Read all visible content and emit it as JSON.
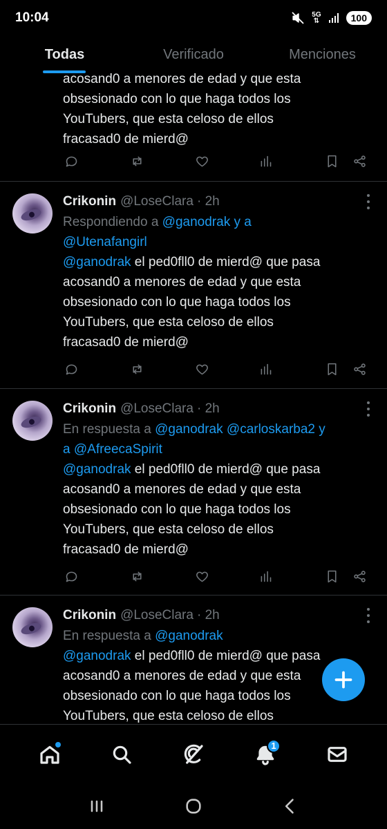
{
  "status_bar": {
    "time": "10:04",
    "network": "5G",
    "battery": "100",
    "icons": [
      "mute-icon",
      "5g-icon",
      "signal-icon",
      "battery-icon"
    ]
  },
  "tabs": [
    {
      "label": "Todas",
      "active": true
    },
    {
      "label": "Verificado",
      "active": false
    },
    {
      "label": "Menciones",
      "active": false
    }
  ],
  "posts": [
    {
      "partial": true,
      "text_lines": [
        "acosand0 a menores de edad y que esta",
        "obsesionado con lo que haga todos los",
        "YouTubers, que esta celoso de ellos",
        "fracasad0 de mierd@"
      ]
    },
    {
      "name": "Crikonin",
      "handle": "@LoseClara",
      "time": "· 2h",
      "reply_prefix": "Respondiendo a",
      "reply_line1_mention": "@ganodrak",
      "reply_line1_suffix": " y a",
      "reply_line2_mention": "@Utenafangirl",
      "text_mention": "@ganodrak",
      "text_first": " el ped0fll0 de mierd@ que pasa",
      "text_lines": [
        "acosand0 a menores de edad y que esta",
        "obsesionado con lo que haga todos los",
        "YouTubers, que esta celoso de ellos",
        "fracasad0 de mierd@"
      ]
    },
    {
      "name": "Crikonin",
      "handle": "@LoseClara",
      "time": "· 2h",
      "reply_prefix": "En respuesta a",
      "reply_mention1": "@ganodrak",
      "reply_mention2": "@carloskarba2",
      "reply_mid": " y",
      "reply_line2_prefix": "a ",
      "reply_line2_mention": "@AfreecaSpirit",
      "text_mention": "@ganodrak",
      "text_first": " el ped0fll0 de mierd@ que pasa",
      "text_lines": [
        "acosand0 a menores de edad y que esta",
        "obsesionado con lo que haga todos los",
        "YouTubers, que esta celoso de ellos",
        "fracasad0 de mierd@"
      ]
    },
    {
      "name": "Crikonin",
      "handle": "@LoseClara",
      "time": "· 2h",
      "reply_prefix": "En respuesta a",
      "reply_mention1": "@ganodrak",
      "text_mention": "@ganodrak",
      "text_first": " el ped0fll0 de mierd@ que pasa",
      "text_lines": [
        "acosand0 a menores de edad y que esta",
        "obsesionado con lo que haga todos los",
        "YouTubers, que esta celoso de ellos"
      ]
    }
  ],
  "post_actions": [
    "reply-icon",
    "retweet-icon",
    "like-icon",
    "views-icon",
    "bookmark-icon",
    "share-icon"
  ],
  "fab": {
    "icon": "plus-icon"
  },
  "bottom_nav": {
    "items": [
      "home-icon",
      "search-icon",
      "grok-icon",
      "notifications-icon",
      "messages-icon"
    ],
    "notifications_badge": "1"
  },
  "system_nav": [
    "recents-icon",
    "home-circle-icon",
    "back-icon"
  ],
  "colors": {
    "accent": "#1d9bf0",
    "background": "#000000",
    "muted": "#71767b",
    "text": "#e7e9ea"
  }
}
